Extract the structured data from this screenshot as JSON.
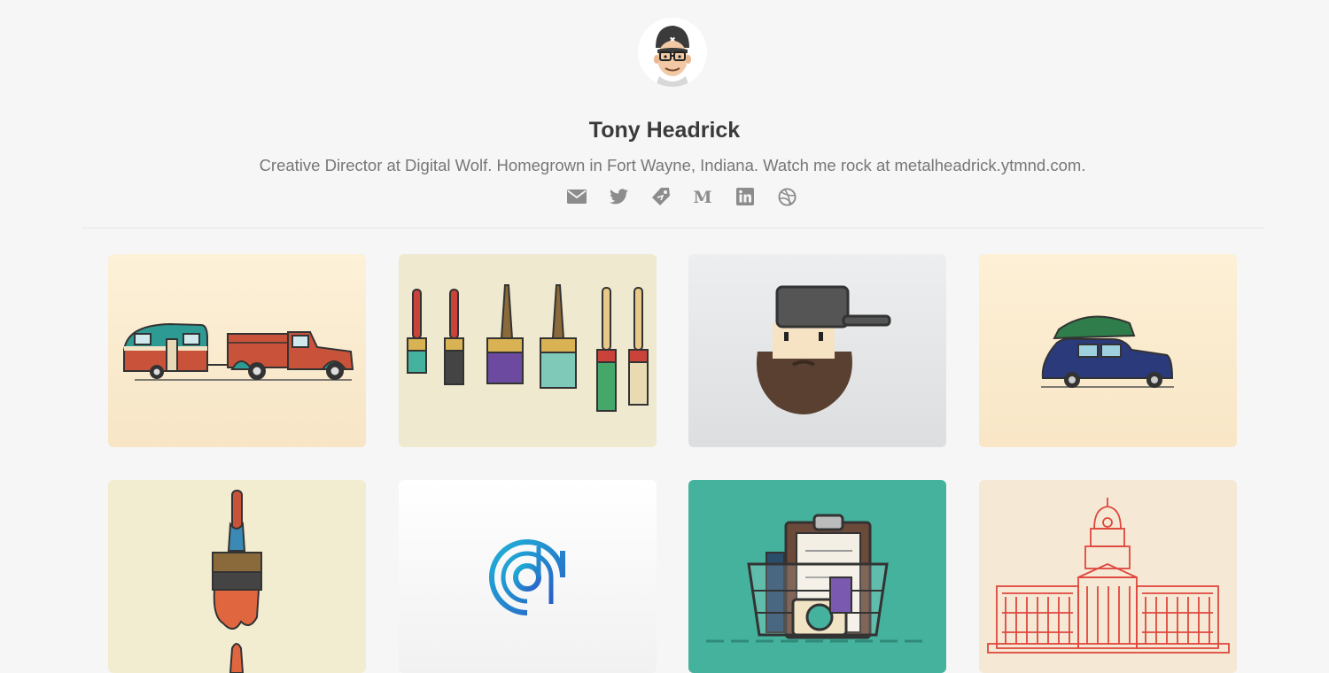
{
  "profile": {
    "name": "Tony Headrick",
    "bio": "Creative Director at Digital Wolf. Homegrown in Fort Wayne, Indiana. Watch me rock at metalheadrick.ytmnd.com.",
    "avatar": "cartoon-portrait-cap-glasses"
  },
  "social": [
    {
      "icon": "mail-icon"
    },
    {
      "icon": "twitter-icon"
    },
    {
      "icon": "tag-icon"
    },
    {
      "icon": "medium-icon"
    },
    {
      "icon": "linkedin-icon"
    },
    {
      "icon": "dribbble-icon"
    }
  ],
  "colors": {
    "background": "#f6f6f6",
    "icon": "#8c8c8c",
    "teal": "#45b29d",
    "divider": "#e6e6e6"
  },
  "shots": [
    {
      "subject": "camper-trailer-and-pickup-truck"
    },
    {
      "subject": "dripping-paint-brushes"
    },
    {
      "subject": "bearded-guy-backwards-cap"
    },
    {
      "subject": "vintage-car-with-tree-on-roof"
    },
    {
      "subject": "single-paint-brush-drip"
    },
    {
      "subject": "blue-circle-d-logo"
    },
    {
      "subject": "clipboard-and-basket"
    },
    {
      "subject": "red-line-capitol-building"
    }
  ]
}
